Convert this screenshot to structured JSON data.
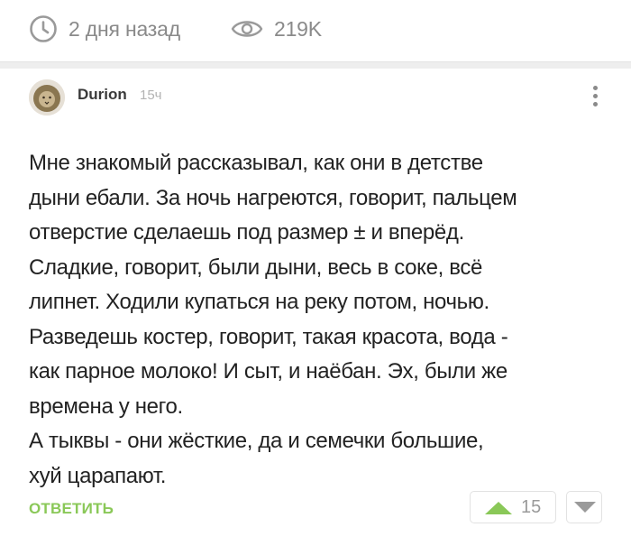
{
  "post_meta": {
    "time_icon": "clock-icon",
    "time_text": "2 дня назад",
    "views_icon": "eye-icon",
    "views_text": "219K"
  },
  "comment": {
    "author": "Durion",
    "age": "15ч",
    "avatar_icon": "lion-avatar",
    "more_icon": "vertical-dots-icon",
    "lines": [
      "Мне знакомый рассказывал, как они в детстве",
      "дыни ебали. За ночь нагреются, говорит, пальцем",
      "отверстие сделаешь под размер ± и вперёд.",
      "Сладкие, говорит, были дыни, весь в соке, всё",
      "липнет. Ходили купаться на реку потом, ночью.",
      "Разведешь костер, говорит, такая красота, вода -",
      "как парное молоко! И сыт, и наёбан. Эх, были же",
      "времена у него.",
      "А тыквы - они жёсткие, да и семечки большие,",
      "хуй царапают."
    ],
    "reply_label": "ОТВЕТИТЬ",
    "rating": "15",
    "upvote_icon": "triangle-up-icon",
    "downvote_icon": "triangle-down-icon"
  },
  "colors": {
    "accent_green": "#8ac858",
    "meta_gray": "#8a8a8a"
  }
}
